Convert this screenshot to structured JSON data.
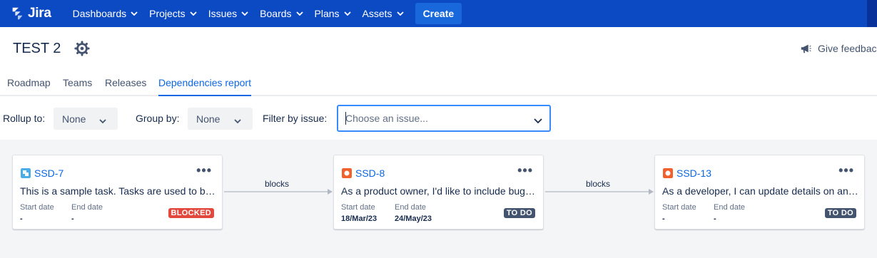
{
  "nav": {
    "logo": "Jira",
    "items": [
      "Dashboards",
      "Projects",
      "Issues",
      "Boards",
      "Plans",
      "Assets"
    ],
    "create": "Create"
  },
  "header": {
    "title": "TEST 2",
    "feedback": "Give feedbac"
  },
  "tabs": [
    "Roadmap",
    "Teams",
    "Releases",
    "Dependencies report"
  ],
  "active_tab": "Dependencies report",
  "filters": {
    "rollup_label": "Rollup to:",
    "rollup_value": "None",
    "group_label": "Group by:",
    "group_value": "None",
    "issue_label": "Filter by issue:",
    "issue_placeholder": "Choose an issue..."
  },
  "cards": [
    {
      "key": "SSD-7",
      "type": "task",
      "summary": "This is a sample task. Tasks are used to break down user stories",
      "start_label": "Start date",
      "start_value": "-",
      "end_label": "End date",
      "end_value": "-",
      "status": "BLOCKED"
    },
    {
      "key": "SSD-8",
      "type": "story",
      "summary": "As a product owner, I'd like to include bugs, tasks and other issue types",
      "start_label": "Start date",
      "start_value": "18/Mar/23",
      "end_label": "End date",
      "end_value": "24/May/23",
      "status": "TO DO"
    },
    {
      "key": "SSD-13",
      "type": "story",
      "summary": "As a developer, I can update details on an item using the Detail View",
      "start_label": "Start date",
      "start_value": "-",
      "end_label": "End date",
      "end_value": "-",
      "status": "TO DO"
    }
  ],
  "links": [
    "blocks",
    "blocks"
  ],
  "colors": {
    "nav_bg": "#0c4ac4",
    "create_bg": "#1868db",
    "link": "#0c66e4",
    "blocked": "#e2483d",
    "todo": "#44546f",
    "task_icon": "#4bade8",
    "story_icon": "#f0612d"
  }
}
